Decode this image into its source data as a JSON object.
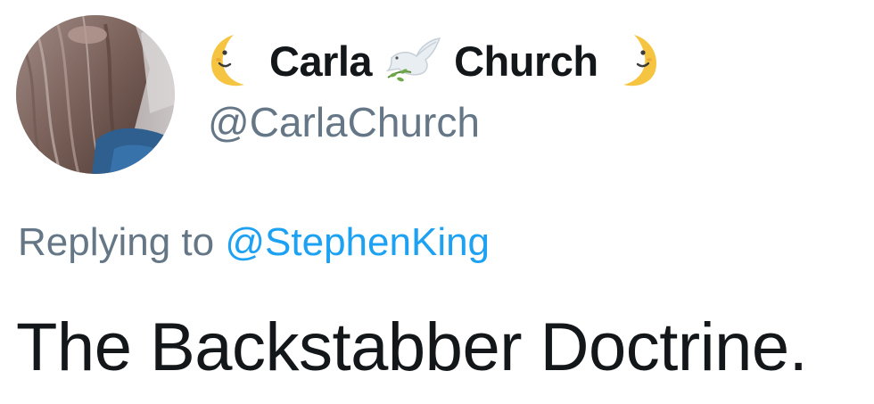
{
  "author": {
    "display_name_first": "Carla",
    "display_name_last": "Church",
    "handle": "@CarlaChurch",
    "name_emojis": [
      "crescent-moon-face-icon",
      "dove-icon",
      "crescent-moon-face-icon"
    ]
  },
  "reply": {
    "prefix": "Replying to",
    "target": "@StephenKing"
  },
  "tweet": {
    "text": "The Backstabber Doctrine."
  },
  "colors": {
    "text": "#14171a",
    "secondary": "#657786",
    "link": "#1da1f2",
    "moon": "#f5c542"
  }
}
